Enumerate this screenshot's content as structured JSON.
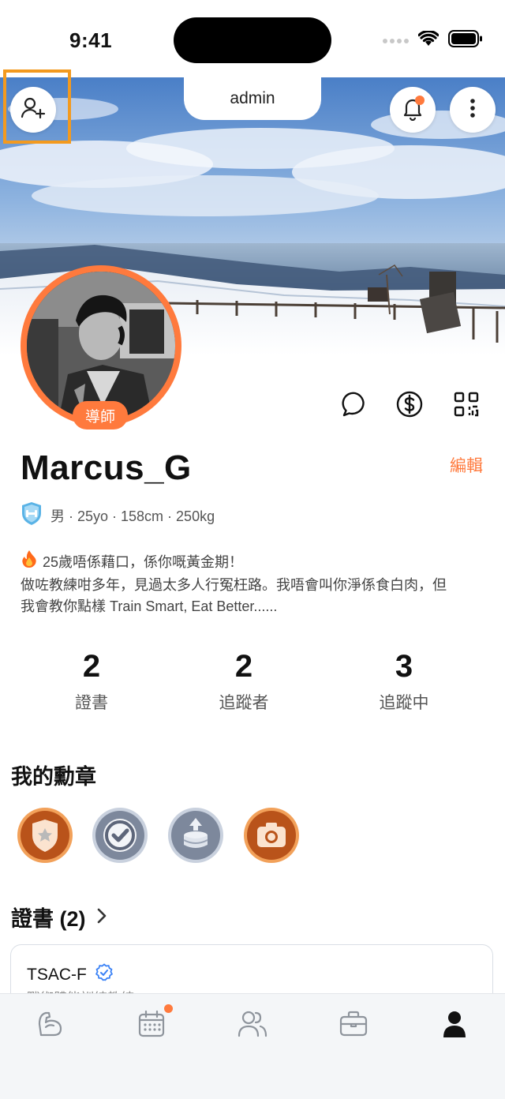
{
  "status_bar": {
    "time": "9:41"
  },
  "header": {
    "tab_label": "admin"
  },
  "profile": {
    "role_badge": "導師",
    "username": "Marcus_G",
    "edit_label": "編輯",
    "meta": "男 · 25yo · 158cm · 250kg",
    "bio_line1": "25歲唔係藉口，係你嘅黃金期！",
    "bio_line2": "做咗教練咁多年，見過太多人行冤枉路。我唔會叫你淨係食白肉，但",
    "bio_line3": "我會教你點樣 Train Smart, Eat Better......"
  },
  "stats": [
    {
      "value": "2",
      "label": "證書"
    },
    {
      "value": "2",
      "label": "追蹤者"
    },
    {
      "value": "3",
      "label": "追蹤中"
    }
  ],
  "badges": {
    "heading": "我的勳章",
    "items": [
      "shield-star-medal-icon",
      "check-medal-icon",
      "stack-medal-icon",
      "camera-medal-icon"
    ]
  },
  "certificates": {
    "heading": "證書 (2)",
    "items": [
      {
        "title": "TSAC-F",
        "subtitle": "戰術體能訓練教練"
      }
    ]
  },
  "bottom_nav": [
    "muscle-icon",
    "calendar-icon",
    "community-icon",
    "briefcase-icon",
    "profile-icon"
  ],
  "colors": {
    "accent": "#ff7a3d",
    "highlight": "#f39a1f",
    "verified": "#3b82f6"
  }
}
